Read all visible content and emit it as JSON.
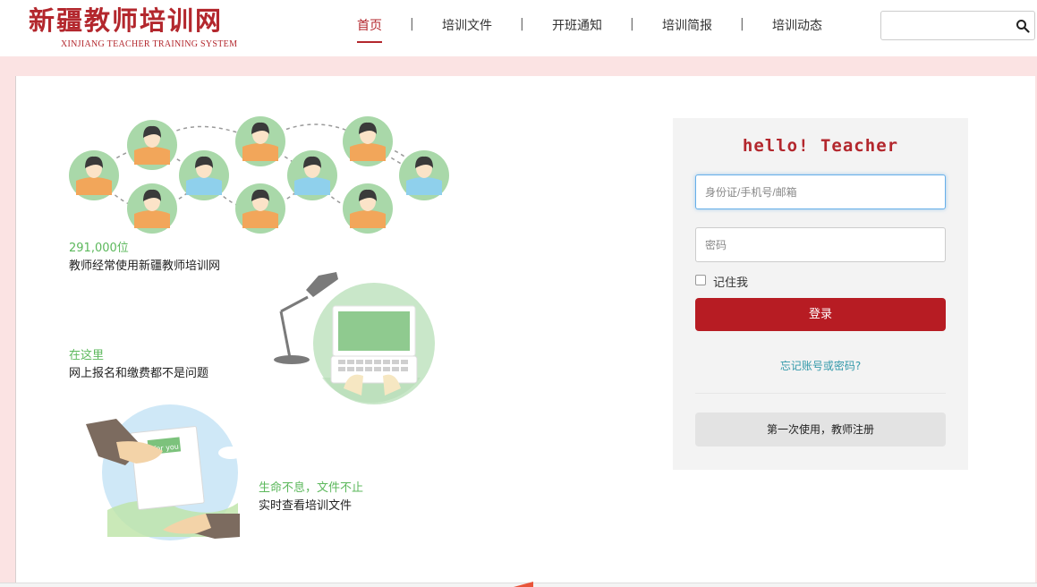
{
  "header": {
    "logo_cn": "新疆教师培训网",
    "logo_en": "XINJIANG TEACHER TRAINING SYSTEM",
    "nav": [
      {
        "label": "首页"
      },
      {
        "label": "培训文件"
      },
      {
        "label": "开班通知"
      },
      {
        "label": "培训简报"
      },
      {
        "label": "培训动态"
      }
    ],
    "separator": "|",
    "search": {
      "value": "",
      "placeholder": "",
      "icon": "search-icon"
    }
  },
  "features": [
    {
      "title": "291,000位",
      "desc": "教师经常使用新疆教师培训网"
    },
    {
      "title": "在这里",
      "desc": "网上报名和缴费都不是问题"
    },
    {
      "title": "生命不息，文件不止",
      "desc": "实时查看培训文件"
    }
  ],
  "login": {
    "greeting": "hello!  Teacher",
    "username_placeholder": "身份证/手机号/邮箱",
    "password_placeholder": "密码",
    "remember_label": "记住我",
    "login_button": "登录",
    "forgot_link": "忘记账号或密码?",
    "register_button": "第一次使用，教师注册"
  },
  "colors": {
    "brand_red": "#b3272d",
    "accent_green": "#5cb85c",
    "link_teal": "#3399aa",
    "page_pink": "#fbe3e3"
  }
}
